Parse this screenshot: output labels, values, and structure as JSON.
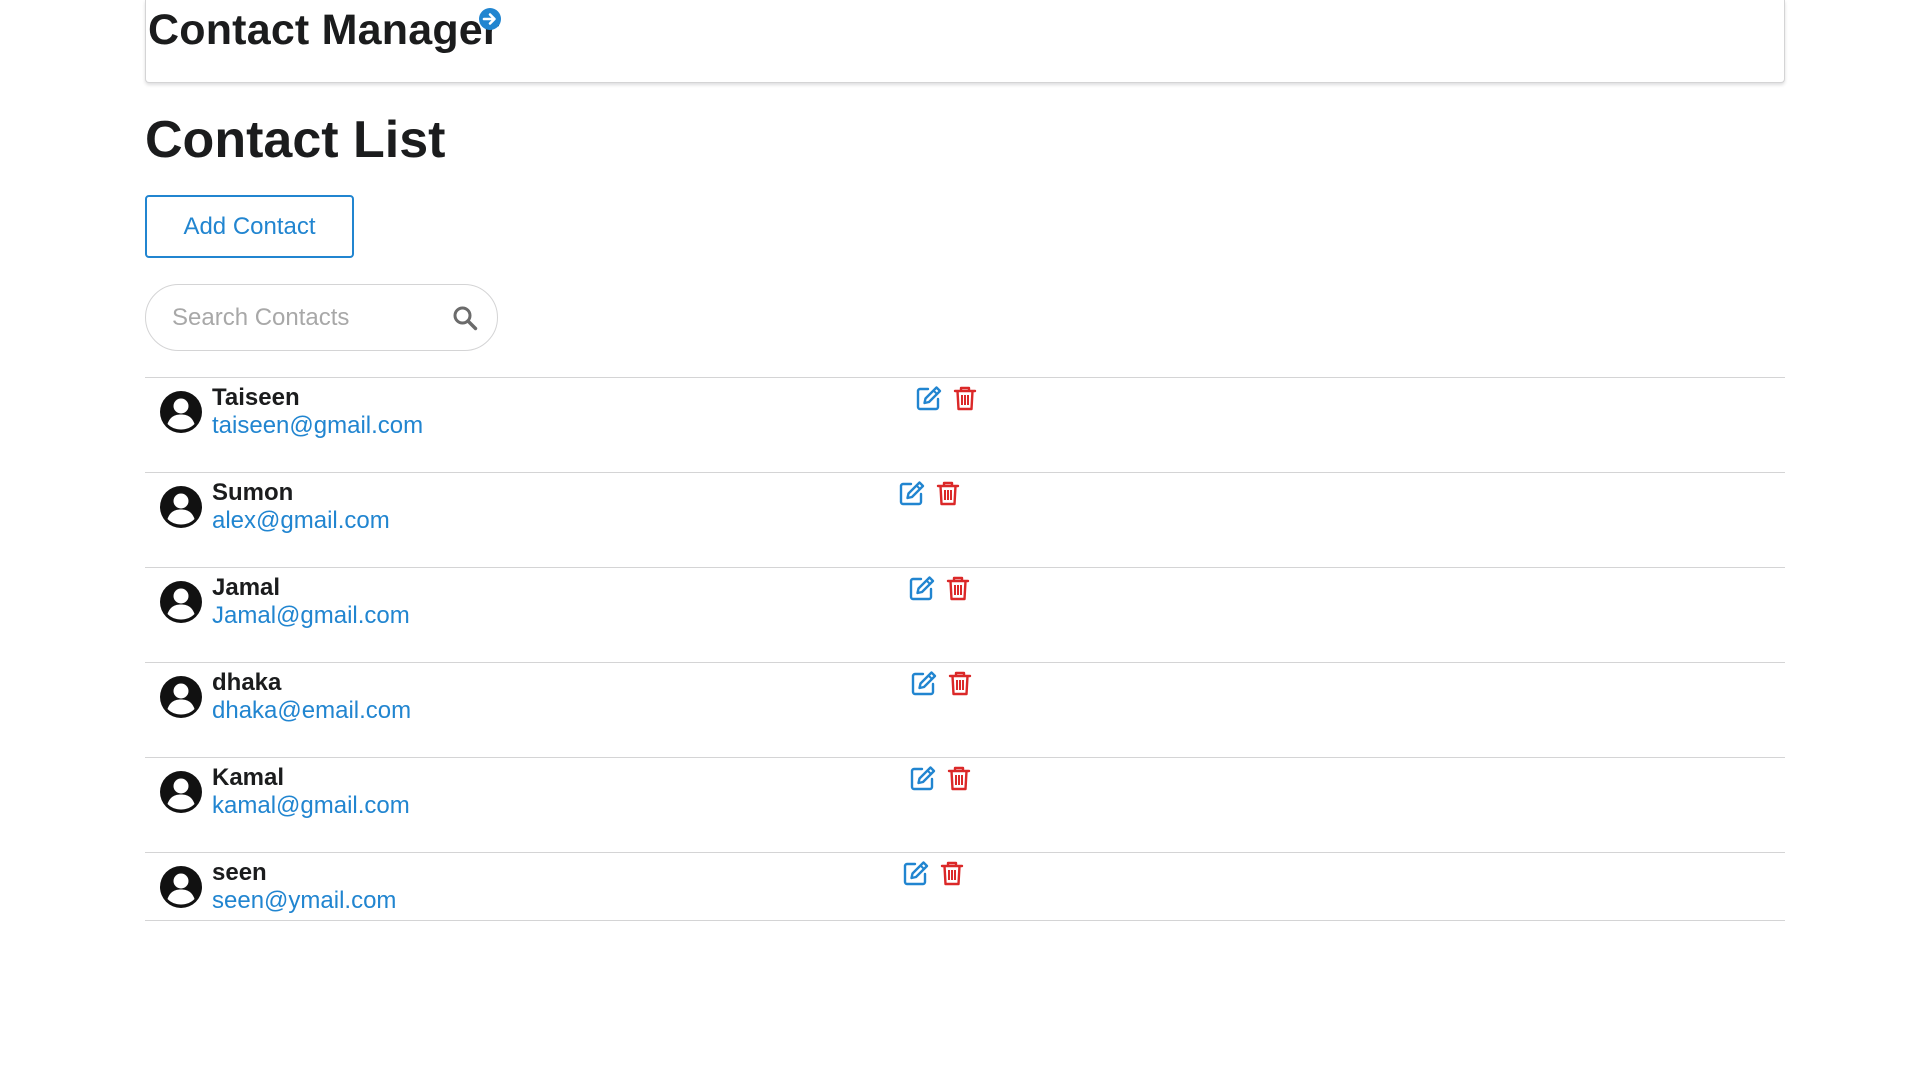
{
  "header": {
    "title": "Contact Manager",
    "link_icon": "arrow-circle-right-icon",
    "accent": "#2185d0"
  },
  "main": {
    "heading": "Contact List",
    "add_button": "Add Contact",
    "search": {
      "placeholder": "Search Contacts",
      "value": "",
      "icon": "search-icon"
    }
  },
  "contacts": [
    {
      "name": "Taiseen",
      "email": "taiseen@gmail.com"
    },
    {
      "name": "Sumon",
      "email": "alex@gmail.com"
    },
    {
      "name": "Jamal",
      "email": "Jamal@gmail.com"
    },
    {
      "name": "dhaka",
      "email": "dhaka@email.com"
    },
    {
      "name": "Kamal",
      "email": "kamal@gmail.com"
    },
    {
      "name": "seen",
      "email": "seen@ymail.com"
    }
  ],
  "icons": {
    "avatar": "user-circle-icon",
    "edit": "edit-icon",
    "delete": "trash-icon"
  },
  "colors": {
    "link": "#2185d0",
    "delete": "#db2828",
    "divider": "#d4d4d5"
  }
}
